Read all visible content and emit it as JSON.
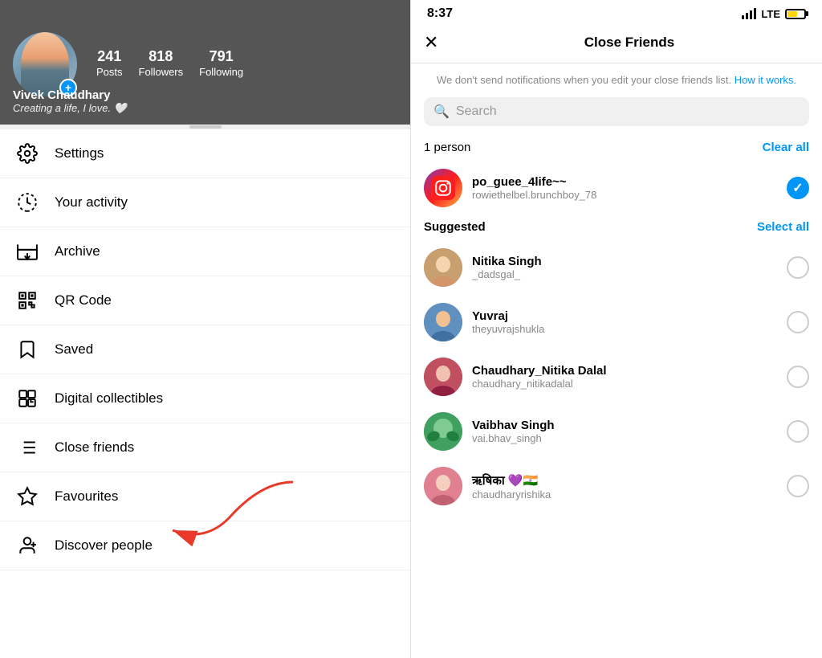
{
  "profile": {
    "name": "Vivek Chaudhary",
    "bio": "Creating a life, I love. 🤍",
    "stats": {
      "posts": {
        "count": "241",
        "label": "Posts"
      },
      "followers": {
        "count": "818",
        "label": "Followers"
      },
      "following": {
        "count": "791",
        "label": "Following"
      }
    }
  },
  "menu": {
    "items": [
      {
        "id": "settings",
        "label": "Settings",
        "icon": "settings-icon"
      },
      {
        "id": "your-activity",
        "label": "Your activity",
        "icon": "activity-icon"
      },
      {
        "id": "archive",
        "label": "Archive",
        "icon": "archive-icon"
      },
      {
        "id": "qr-code",
        "label": "QR Code",
        "icon": "qr-icon"
      },
      {
        "id": "saved",
        "label": "Saved",
        "icon": "saved-icon"
      },
      {
        "id": "digital-collectibles",
        "label": "Digital collectibles",
        "icon": "collectibles-icon"
      },
      {
        "id": "close-friends",
        "label": "Close friends",
        "icon": "close-friends-icon"
      },
      {
        "id": "favourites",
        "label": "Favourites",
        "icon": "favourites-icon"
      },
      {
        "id": "discover-people",
        "label": "Discover people",
        "icon": "discover-icon"
      }
    ]
  },
  "right_panel": {
    "status_bar": {
      "time": "8:37",
      "lte": "LTE"
    },
    "title": "Close Friends",
    "subtitle": "We don't send notifications when you edit your close friends list.",
    "subtitle_link": "How it works.",
    "search_placeholder": "Search",
    "selected_count": "1 person",
    "clear_all": "Clear all",
    "suggested_label": "Suggested",
    "select_all": "Select all",
    "selected_friend": {
      "username": "po_guee_4life~~",
      "handle": "rowiethelbel.brunchboy_78",
      "checked": true
    },
    "suggested_friends": [
      {
        "name": "Nitika Singh",
        "handle": "_dadsgal_"
      },
      {
        "name": "Yuvraj",
        "handle": "theyuvrajshukla"
      },
      {
        "name": "Chaudhary_Nitika Dalal",
        "handle": "chaudhary_nitikadalal"
      },
      {
        "name": "Vaibhav Singh",
        "handle": "vai.bhav_singh"
      },
      {
        "name": "ऋषिका 💜🇮🇳",
        "handle": "chaudharyrishika"
      }
    ]
  }
}
